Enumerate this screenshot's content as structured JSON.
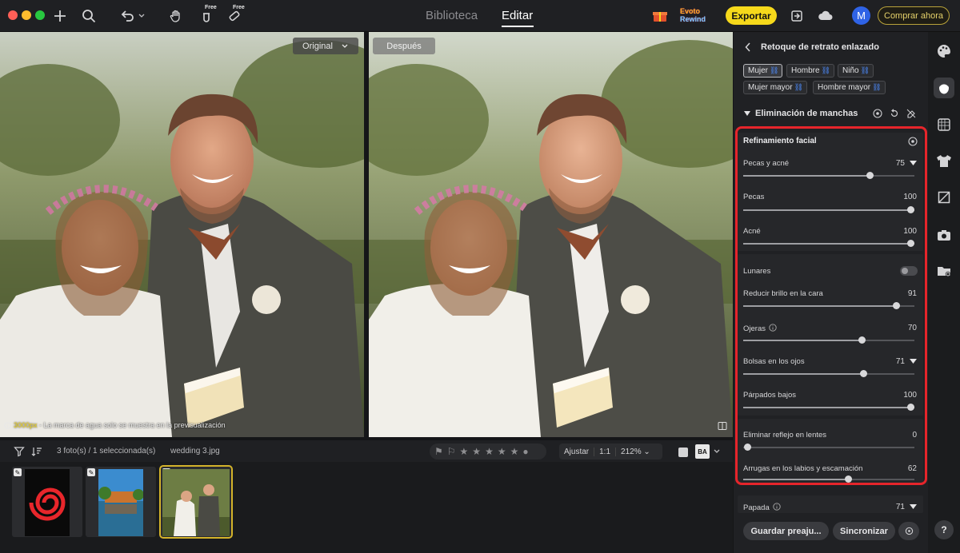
{
  "titlebar": {
    "nav_tabs": [
      "Biblioteca",
      "Editar"
    ],
    "active_tab": "Editar",
    "free_badge": "Free",
    "promo_line1": "Evoto",
    "promo_line2": "Rewind",
    "export_label": "Exportar",
    "avatar_letter": "M",
    "buy_label": "Comprar ahora"
  },
  "viewer": {
    "original_label": "Original",
    "after_label": "Después",
    "watermark_px": "3000px",
    "watermark_text": " - La marca de agua solo se muestra en la previsualización"
  },
  "bottom_bar": {
    "photo_count": "3 foto(s) / 1 seleccionada(s)",
    "filename": "wedding 3.jpg",
    "fit_label": "Ajustar",
    "one_to_one": "1:1",
    "zoom": "212%",
    "ba_label": "BA"
  },
  "filmstrip": {
    "thumbnails": [
      {
        "name": "spiral",
        "selected": false
      },
      {
        "name": "building-reflection",
        "selected": false
      },
      {
        "name": "wedding-3",
        "selected": true
      }
    ]
  },
  "panel": {
    "title": "Retoque de retrato enlazado",
    "chips": [
      "Mujer",
      "Hombre",
      "Niño",
      "Mujer mayor",
      "Hombre mayor"
    ],
    "active_chip": "Mujer",
    "section_title": "Eliminación de manchas",
    "subsection_title": "Refinamiento facial",
    "sliders": [
      {
        "label": "Pecas y acné",
        "value": 75,
        "expand": true
      },
      {
        "label": "Pecas",
        "value": 100
      },
      {
        "label": "Acné",
        "value": 100
      },
      {
        "label": "Reducir brillo en la cara",
        "value": 91
      },
      {
        "label": "Ojeras",
        "value": 70,
        "info": true
      },
      {
        "label": "Bolsas en los ojos",
        "value": 71,
        "expand": true
      },
      {
        "label": "Párpados bajos",
        "value": 100
      },
      {
        "label": "Eliminar reflejo en lentes",
        "value": 0
      },
      {
        "label": "Arrugas en los labios y escamación",
        "value": 62
      },
      {
        "label": "Papada",
        "value": 71,
        "info": true,
        "expand": true
      }
    ],
    "toggle_label": "Lunares",
    "toggle_on": false,
    "save_preset_label": "Guardar preaju...",
    "sync_label": "Sincronizar"
  },
  "help_label": "?"
}
